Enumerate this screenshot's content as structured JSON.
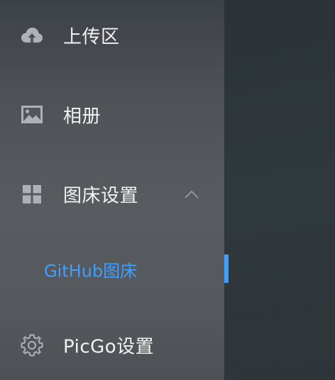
{
  "colors": {
    "label": "#f2f2f2",
    "icon": "#aeb1b5",
    "active": "#409eff"
  },
  "menu": {
    "upload": {
      "label": "上传区",
      "icon": "cloud-upload-icon"
    },
    "gallery": {
      "label": "相册",
      "icon": "picture-icon"
    },
    "bed_settings": {
      "label": "图床设置",
      "icon": "grid-icon",
      "expanded": true,
      "submenu": [
        {
          "label": "GitHub图床",
          "active": true
        }
      ]
    },
    "picgo_settings": {
      "label": "PicGo设置",
      "icon": "gear-icon"
    }
  }
}
